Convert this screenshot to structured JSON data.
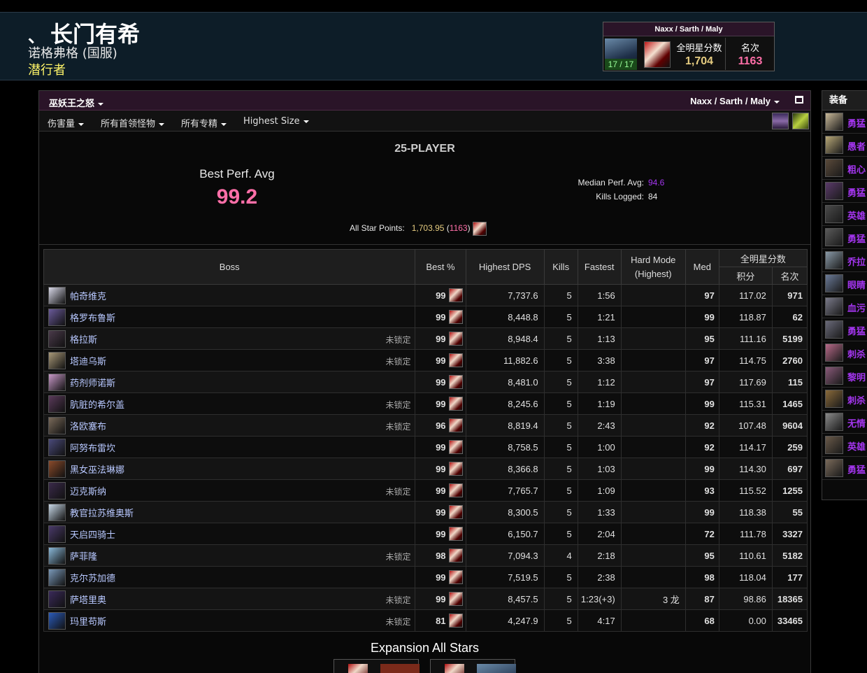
{
  "character": {
    "name": "长门有希",
    "realm": "诺格弗格 (国服)",
    "class": "潜行者"
  },
  "header_widget": {
    "title": "Naxx / Sarth / Maly",
    "progress": "17 / 17",
    "points_label": "全明星分数",
    "points_value": "1,704",
    "rank_label": "名次",
    "rank_value": "1163"
  },
  "toolbar": {
    "expansion": "巫妖王之怒",
    "zone": "Naxx / Sarth / Maly",
    "filters": [
      "伤害量",
      "所有首领怪物",
      "所有专精",
      "Highest Size"
    ]
  },
  "summary": {
    "size_title": "25-PLAYER",
    "best_perf_label": "Best Perf. Avg",
    "best_perf_value": "99.2",
    "median_label": "Median Perf. Avg:",
    "median_value": "94.6",
    "kills_label": "Kills Logged:",
    "kills_value": "84",
    "all_star_label": "All Star Points:",
    "all_star_value": "1,703.95",
    "all_star_rank": "1163"
  },
  "table": {
    "headers": {
      "boss": "Boss",
      "best": "Best %",
      "dps": "Highest DPS",
      "kills": "Kills",
      "fastest": "Fastest",
      "hardmode_1": "Hard Mode",
      "hardmode_2": "(Highest)",
      "med": "Med",
      "allstar": "全明星分数",
      "points": "积分",
      "rank": "名次"
    },
    "locked_text": "未锁定",
    "rows": [
      {
        "boss": "帕奇维克",
        "locked": false,
        "best": "99",
        "best_color": "pink",
        "dps": "7,737.6",
        "kills": "5",
        "fastest": "1:56",
        "hard": "",
        "med": "97",
        "med_color": "orange",
        "points": "117.02",
        "rank": "971",
        "rank_color": "pink",
        "icon": "#d8d8e8"
      },
      {
        "boss": "格罗布鲁斯",
        "locked": false,
        "best": "99",
        "best_color": "pink",
        "dps": "8,448.8",
        "kills": "5",
        "fastest": "1:21",
        "hard": "",
        "med": "99",
        "med_color": "pink",
        "points": "118.87",
        "rank": "62",
        "rank_color": "pink",
        "icon": "#6a5a9a"
      },
      {
        "boss": "格拉斯",
        "locked": true,
        "best": "99",
        "best_color": "pink",
        "dps": "8,948.4",
        "kills": "5",
        "fastest": "1:13",
        "hard": "",
        "med": "95",
        "med_color": "orange",
        "points": "111.16",
        "rank": "5199",
        "rank_color": "orange",
        "icon": "#4a3a4a"
      },
      {
        "boss": "塔迪乌斯",
        "locked": true,
        "best": "99",
        "best_color": "pink",
        "dps": "11,882.6",
        "kills": "5",
        "fastest": "3:38",
        "hard": "",
        "med": "97",
        "med_color": "orange",
        "points": "114.75",
        "rank": "2760",
        "rank_color": "orange",
        "icon": "#a89878"
      },
      {
        "boss": "药剂师诺斯",
        "locked": false,
        "best": "99",
        "best_color": "pink",
        "dps": "8,481.0",
        "kills": "5",
        "fastest": "1:12",
        "hard": "",
        "med": "97",
        "med_color": "orange",
        "points": "117.69",
        "rank": "115",
        "rank_color": "pink",
        "icon": "#c898c8"
      },
      {
        "boss": "肮脏的希尔盖",
        "locked": true,
        "best": "99",
        "best_color": "pink",
        "dps": "8,245.6",
        "kills": "5",
        "fastest": "1:19",
        "hard": "",
        "med": "99",
        "med_color": "pink",
        "points": "115.31",
        "rank": "1465",
        "rank_color": "orange",
        "icon": "#5a3a5a"
      },
      {
        "boss": "洛欧塞布",
        "locked": true,
        "best": "96",
        "best_color": "orange",
        "dps": "8,819.4",
        "kills": "5",
        "fastest": "2:43",
        "hard": "",
        "med": "92",
        "med_color": "purple",
        "points": "107.48",
        "rank": "9604",
        "rank_color": "purple",
        "icon": "#7a6a5a"
      },
      {
        "boss": "阿努布雷坎",
        "locked": false,
        "best": "99",
        "best_color": "pink",
        "dps": "8,758.5",
        "kills": "5",
        "fastest": "1:00",
        "hard": "",
        "med": "92",
        "med_color": "purple",
        "points": "114.17",
        "rank": "259",
        "rank_color": "pink",
        "icon": "#4a4a7a"
      },
      {
        "boss": "黑女巫法琳娜",
        "locked": false,
        "best": "99",
        "best_color": "pink",
        "dps": "8,366.8",
        "kills": "5",
        "fastest": "1:03",
        "hard": "",
        "med": "99",
        "med_color": "pink",
        "points": "114.30",
        "rank": "697",
        "rank_color": "pink",
        "icon": "#8a4a2a"
      },
      {
        "boss": "迈克斯纳",
        "locked": true,
        "best": "99",
        "best_color": "pink",
        "dps": "7,765.7",
        "kills": "5",
        "fastest": "1:09",
        "hard": "",
        "med": "93",
        "med_color": "purple",
        "points": "115.52",
        "rank": "1255",
        "rank_color": "orange",
        "icon": "#3a2a4a"
      },
      {
        "boss": "教官拉苏维奥斯",
        "locked": false,
        "best": "99",
        "best_color": "pink",
        "dps": "8,300.5",
        "kills": "5",
        "fastest": "1:33",
        "hard": "",
        "med": "99",
        "med_color": "pink",
        "points": "118.38",
        "rank": "55",
        "rank_color": "pink",
        "icon": "#c8d8e8"
      },
      {
        "boss": "天启四骑士",
        "locked": false,
        "best": "99",
        "best_color": "pink",
        "dps": "6,150.7",
        "kills": "5",
        "fastest": "2:04",
        "hard": "",
        "med": "72",
        "med_color": "blue",
        "points": "111.78",
        "rank": "3327",
        "rank_color": "orange",
        "icon": "#4a3a6a"
      },
      {
        "boss": "萨菲隆",
        "locked": true,
        "best": "98",
        "best_color": "orange",
        "dps": "7,094.3",
        "kills": "4",
        "fastest": "2:18",
        "hard": "",
        "med": "95",
        "med_color": "orange",
        "points": "110.61",
        "rank": "5182",
        "rank_color": "orange",
        "icon": "#8ab8d8"
      },
      {
        "boss": "克尔苏加德",
        "locked": false,
        "best": "99",
        "best_color": "pink",
        "dps": "7,519.5",
        "kills": "5",
        "fastest": "2:38",
        "hard": "",
        "med": "98",
        "med_color": "orange",
        "points": "118.04",
        "rank": "177",
        "rank_color": "pink",
        "icon": "#7a98b8"
      },
      {
        "boss": "萨塔里奥",
        "locked": true,
        "best": "99",
        "best_color": "pink",
        "dps": "8,457.5",
        "kills": "5",
        "fastest": "1:23(+3)",
        "hard": "3 龙",
        "med": "87",
        "med_color": "purple",
        "points": "98.86",
        "rank": "18365",
        "rank_color": "purple",
        "icon": "#3a2a5a"
      },
      {
        "boss": "玛里苟斯",
        "locked": true,
        "best": "81",
        "best_color": "purple",
        "dps": "4,247.9",
        "kills": "5",
        "fastest": "4:17",
        "hard": "",
        "med": "68",
        "med_color": "blue",
        "points": "0.00",
        "rank": "33465",
        "rank_color": "blue",
        "icon": "#2a5ab8"
      }
    ]
  },
  "expansion_all_stars": {
    "title": "Expansion All Stars"
  },
  "gear": {
    "title": "装备",
    "items": [
      {
        "name": "勇猛",
        "icon": "#c8b898"
      },
      {
        "name": "愚者",
        "icon": "#b8a878"
      },
      {
        "name": "粗心",
        "icon": "#5a4a3a"
      },
      {
        "name": "勇猛",
        "icon": "#5a3a6a"
      },
      {
        "name": "英雄",
        "icon": "#4a4a4a"
      },
      {
        "name": "勇猛",
        "icon": "#5a5a5a"
      },
      {
        "name": "乔拉",
        "icon": "#8a9aa8"
      },
      {
        "name": "眼睛",
        "icon": "#6a7a98"
      },
      {
        "name": "血污",
        "icon": "#7a7a8a"
      },
      {
        "name": "勇猛",
        "icon": "#6a6a7a"
      },
      {
        "name": "刺杀",
        "icon": "#b86a8a"
      },
      {
        "name": "黎明",
        "icon": "#8a5a7a"
      },
      {
        "name": "刺杀",
        "icon": "#8a6a3a"
      },
      {
        "name": "无情",
        "icon": "#8a8a8a"
      },
      {
        "name": "英雄",
        "icon": "#6a5a4a"
      },
      {
        "name": "勇猛",
        "icon": "#7a6a5a"
      }
    ]
  },
  "colors": {
    "pink": "#ff6fa8",
    "orange": "#ff8000",
    "purple": "#a335ee",
    "blue": "#1e90ff",
    "gold": "#e6cc80",
    "class_rogue": "#fff569"
  }
}
